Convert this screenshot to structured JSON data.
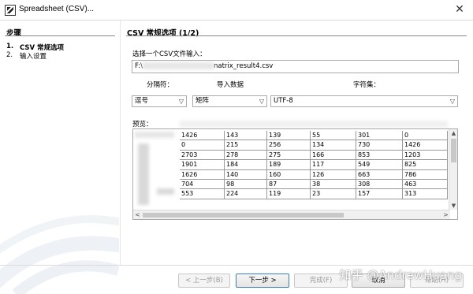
{
  "window": {
    "title": "Spreadsheet (CSV)...",
    "close_glyph": "✕"
  },
  "steps": {
    "heading": "步骤",
    "items": [
      {
        "num": "1.",
        "label": "CSV 常规选项"
      },
      {
        "num": "2.",
        "label": "输入设置"
      }
    ]
  },
  "panel": {
    "heading": "CSV 常规选项 (1/2)",
    "file_label": "选择一个CSV文件输入：",
    "file_value_prefix": "F:\\",
    "file_value_suffix": "natrix_result4.csv",
    "separator_label": "分隔符：",
    "import_label": "导入数据",
    "charset_label": "字符集：",
    "separator_value": "逗号",
    "import_value": "矩阵",
    "charset_value": "UTF-8",
    "preview_label": "预览："
  },
  "preview": {
    "rows": [
      [
        "1426",
        "143",
        "139",
        "55",
        "301",
        "0"
      ],
      [
        "0",
        "215",
        "256",
        "134",
        "730",
        "1426"
      ],
      [
        "2703",
        "278",
        "275",
        "166",
        "853",
        "1203"
      ],
      [
        "1901",
        "184",
        "189",
        "117",
        "549",
        "825"
      ],
      [
        "1626",
        "140",
        "160",
        "126",
        "663",
        "786"
      ],
      [
        "704",
        "98",
        "87",
        "38",
        "308",
        "463"
      ],
      [
        "553",
        "224",
        "119",
        "23",
        "157",
        "313"
      ]
    ]
  },
  "buttons": {
    "back": "< 上一步(B)",
    "next": "下一步 >",
    "finish": "完成(F)",
    "cancel": "取消",
    "help": "帮助(H)"
  },
  "watermark": "知乎 @AndrewHuang",
  "colors": {
    "accent": "#3c7fb1",
    "grid": "#999999"
  }
}
